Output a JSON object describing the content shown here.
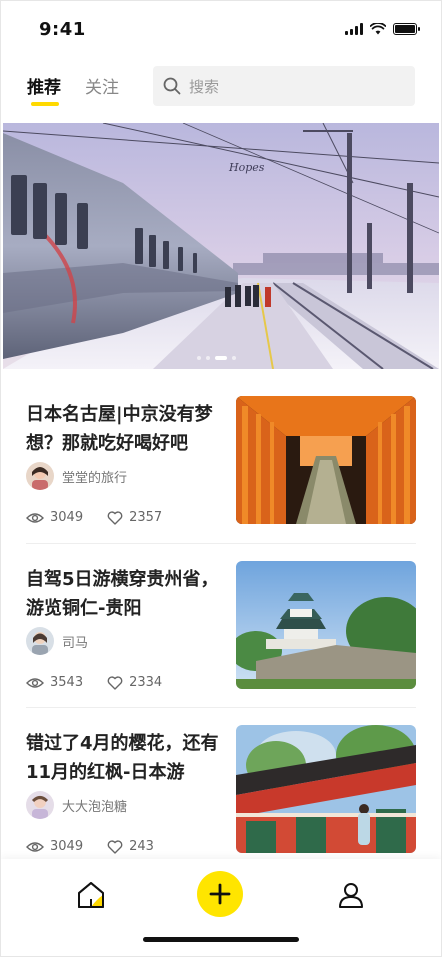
{
  "status": {
    "time": "9:41"
  },
  "header": {
    "tabs": [
      {
        "label": "推荐",
        "active": true
      },
      {
        "label": "关注",
        "active": false
      }
    ],
    "search_placeholder": "搜索"
  },
  "banner": {
    "overlay_text": "Hopes",
    "slides": 4,
    "active_slide": 3
  },
  "feed": [
    {
      "title": "日本名古屋|中京没有梦想？那就吃好喝好吧",
      "author": "堂堂的旅行",
      "views": "3049",
      "likes": "2357",
      "thumb": "torii-gates"
    },
    {
      "title": "自驾5日游横穿贵州省，游览铜仁-贵阳",
      "author": "司马",
      "views": "3543",
      "likes": "2334",
      "thumb": "japanese-castle"
    },
    {
      "title": "错过了4月的樱花，还有11月的红枫-日本游",
      "author": "大大泡泡糖",
      "views": "3049",
      "likes": "243",
      "thumb": "red-shrine"
    }
  ],
  "tabbar": {
    "items": [
      "home-icon",
      "add-icon",
      "profile-icon"
    ]
  },
  "colors": {
    "accent": "#ffd900",
    "add_button": "#ffe500"
  }
}
